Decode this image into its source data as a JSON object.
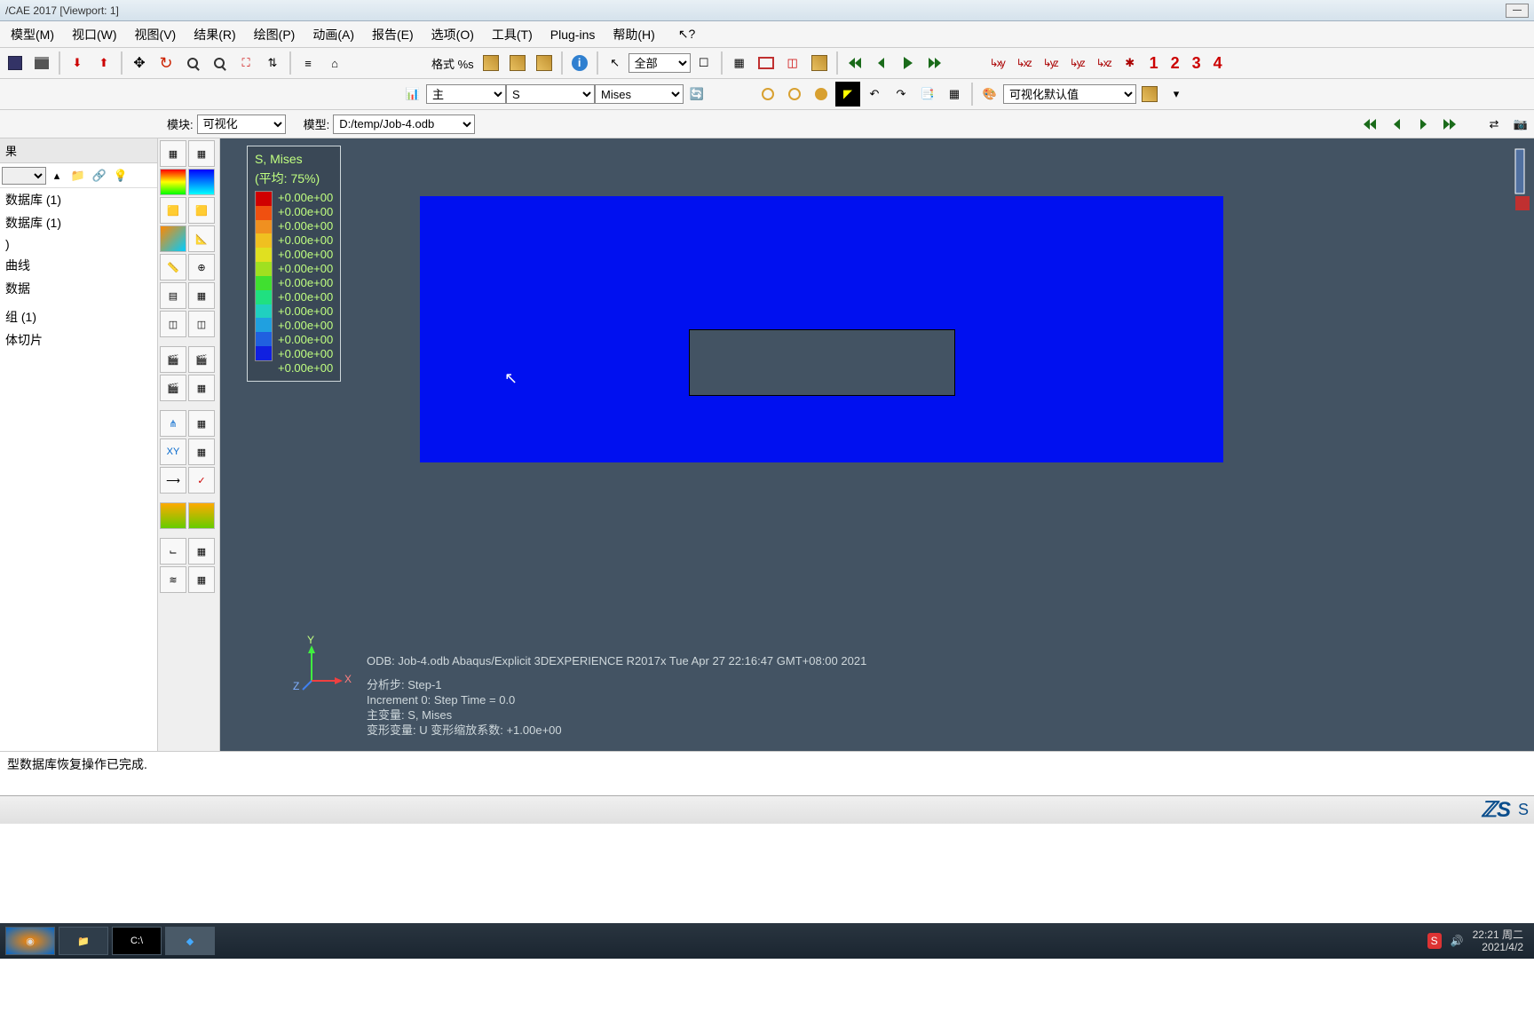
{
  "titlebar": {
    "text": "/CAE 2017 [Viewport: 1]"
  },
  "menubar": {
    "items": [
      "模型(M)",
      "视口(W)",
      "视图(V)",
      "结果(R)",
      "绘图(P)",
      "动画(A)",
      "报告(E)",
      "选项(O)",
      "工具(T)",
      "Plug-ins",
      "帮助(H)"
    ]
  },
  "toolbar1": {
    "format_label": "格式 %s",
    "select_all": "全部",
    "numbers": [
      "1",
      "2",
      "3",
      "4"
    ]
  },
  "toolbar2": {
    "primary": "主",
    "var1": "S",
    "var2": "Mises",
    "style_label": "可视化默认值"
  },
  "context": {
    "module_label": "模块:",
    "module_value": "可视化",
    "model_label": "模型:",
    "model_value": "D:/temp/Job-4.odb"
  },
  "left_panel": {
    "header": "果",
    "tree": [
      "数据库 (1)",
      "数据库 (1)",
      ")",
      "曲线",
      "数据",
      "",
      "组 (1)",
      "体切片"
    ]
  },
  "legend": {
    "title1": "S, Mises",
    "title2": "(平均: 75%)",
    "values": [
      "+0.00e+00",
      "+0.00e+00",
      "+0.00e+00",
      "+0.00e+00",
      "+0.00e+00",
      "+0.00e+00",
      "+0.00e+00",
      "+0.00e+00",
      "+0.00e+00",
      "+0.00e+00",
      "+0.00e+00",
      "+0.00e+00",
      "+0.00e+00"
    ],
    "colors": [
      "#d00000",
      "#f05010",
      "#f09020",
      "#f0c020",
      "#e0e020",
      "#a0e020",
      "#40e030",
      "#20e080",
      "#20d0c0",
      "#20a0e0",
      "#2060e0",
      "#1020e0"
    ]
  },
  "triad": {
    "x": "X",
    "y": "Y",
    "z": "Z"
  },
  "viewport_info": {
    "line1": "ODB: Job-4.odb    Abaqus/Explicit 3DEXPERIENCE R2017x    Tue Apr 27 22:16:47 GMT+08:00 2021",
    "line2": "分析步: Step-1",
    "line3": "Increment       0: Step Time = 0.0",
    "line4": "主变量: S, Mises",
    "line5": "变形变量: U  变形缩放系数: +1.00e+00"
  },
  "message": "型数据库恢复操作已完成.",
  "footer_brand": "S",
  "taskbar": {
    "time": "22:21 周二",
    "date": "2021/4/2"
  }
}
